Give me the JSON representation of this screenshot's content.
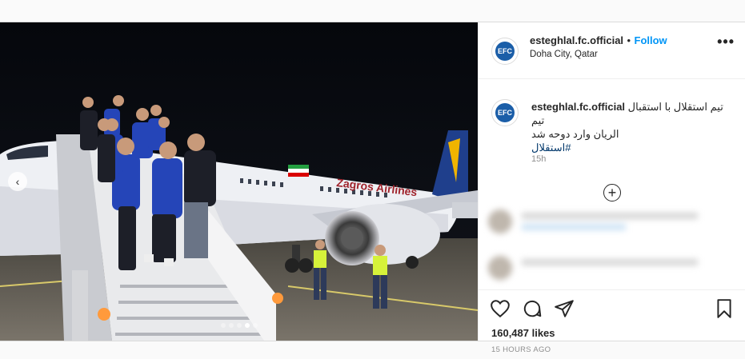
{
  "post": {
    "username": "esteghlal.fc.official",
    "separator": "•",
    "follow_label": "Follow",
    "location": "Doha City, Qatar",
    "more_icon": "more-dots-icon",
    "more_label": "•••",
    "caption_line1": "تیم استقلال با استقبال تیم",
    "caption_line2": "الریان وارد دوحه شد",
    "hashtag": "#استقلال",
    "caption_time": "15h",
    "load_more_icon": "plus-circle-icon",
    "likes": "160,487 likes",
    "posted_ago": "15 HOURS AGO",
    "nav_prev_label": "‹"
  },
  "photo": {
    "airline_text": "Zagros Airlines",
    "description_icon": "team-photo"
  },
  "colors": {
    "link": "#0095f6",
    "hashtag": "#00376b",
    "meta": "#8e8e8e",
    "text": "#262626"
  },
  "actions": [
    "heart-icon",
    "comment-icon",
    "share-icon",
    "bookmark-icon"
  ]
}
